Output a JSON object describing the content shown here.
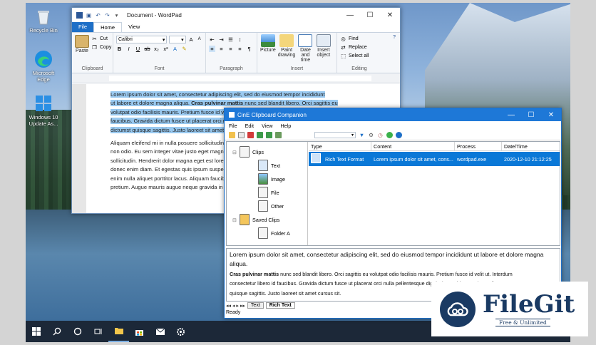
{
  "desktop": {
    "icons": [
      {
        "label": "Recycle Bin",
        "icon": "recycle-bin-icon"
      },
      {
        "label": "Microsoft Edge",
        "icon": "edge-icon"
      },
      {
        "label": "Windows 10 Update As...",
        "icon": "windows-update-icon"
      }
    ]
  },
  "wordpad": {
    "title": "Document - WordPad",
    "tabs": [
      "File",
      "Home",
      "View"
    ],
    "clipboard": {
      "paste": "Paste",
      "cut": "Cut",
      "copy": "Copy",
      "label": "Clipboard"
    },
    "font": {
      "family": "Calibri",
      "size": "",
      "label": "Font"
    },
    "paragraph": {
      "label": "Paragraph"
    },
    "insert": {
      "picture": "Picture",
      "paint": "Paint drawing",
      "datetime": "Date and time",
      "object": "Insert object",
      "label": "Insert"
    },
    "editing": {
      "find": "Find",
      "replace": "Replace",
      "select_all": "Select all",
      "label": "Editing"
    },
    "doc": {
      "p1_sel_a": "Lorem ipsum dolor sit amet, consectetur adipiscing elit, sed do eiusmod tempor incididunt",
      "p1_sel_b": "ut labore et dolore magna aliqua. ",
      "p1_bold": "Cras pulvinar mattis",
      "p1_sel_c": " nunc sed blandit libero. Orci sagittis eu",
      "p1_line3": "volutpat odio facilisis mauris. Pretium fusce id velit ut tortor.",
      "p1_line4": "faucibus. Gravida dictum fusce ut placerat orci nulla pellentesque.",
      "p1_line5": "dictumst quisque sagittis. Justo laoreet sit amet cursus sit.",
      "p2_line1": "Aliquam eleifend mi in nulla posuere sollicitudin aliquam ultrices.",
      "p2_line2": "non odio. Eu sem integer vitae justo eget magna fermentum iaculis.",
      "p2_line3": "sollicitudin. Hendrerit dolor magna eget est lorem ipsum dolor.",
      "p2_line4": "donec enim diam. Et egestas quis ipsum suspendisse ultrices.",
      "p2_line5": "enim nulla aliquet porttitor lacus. Aliquam faucibus purus in.",
      "p2_line6": "pretium. Augue mauris augue neque gravida in fermentum."
    }
  },
  "clipboard_companion": {
    "title": "CinE Clipboard Companion",
    "menu": [
      "File",
      "Edit",
      "View",
      "Help"
    ],
    "tree": {
      "clips": "Clips",
      "text": "Text",
      "image": "Image",
      "file": "File",
      "other": "Other",
      "saved_clips": "Saved Clips",
      "folder_a": "Folder A"
    },
    "list": {
      "columns": [
        "Type",
        "Content",
        "Process",
        "Date/Time"
      ],
      "rows": [
        {
          "type": "Rich Text Format",
          "content": "Lorem ipsum dolor sit amet, cons...",
          "process": "wordpad.exe",
          "datetime": "2020-12-10 21:12:25"
        }
      ]
    },
    "preview": {
      "line1": "Lorem ipsum dolor sit amet, consectetur adipiscing elit, sed do eiusmod tempor incididunt ut labore et dolore magna aliqua.",
      "line2_bold": "Cras pulvinar mattis",
      "line2_rest": " nunc sed blandit libero. Orci sagittis eu volutpat odio facilisis mauris. Pretium fusce id velit ut. Interdum",
      "line3": "consectetur libero id faucibus. Gravida dictum fusce ut placerat orci nulla pellentesque dignissim. Habitasse platea dictumst",
      "line4": "quisque sagittis. Justo laoreet sit amet cursus sit."
    },
    "tabs": [
      "Text",
      "Rich Text"
    ],
    "status": "Ready"
  },
  "watermark": {
    "name": "FileGit",
    "tagline": "Free & Unlimited"
  },
  "colors": {
    "accent": "#1e78d7",
    "selection": "#0a78d7",
    "brand": "#1a3a63"
  }
}
